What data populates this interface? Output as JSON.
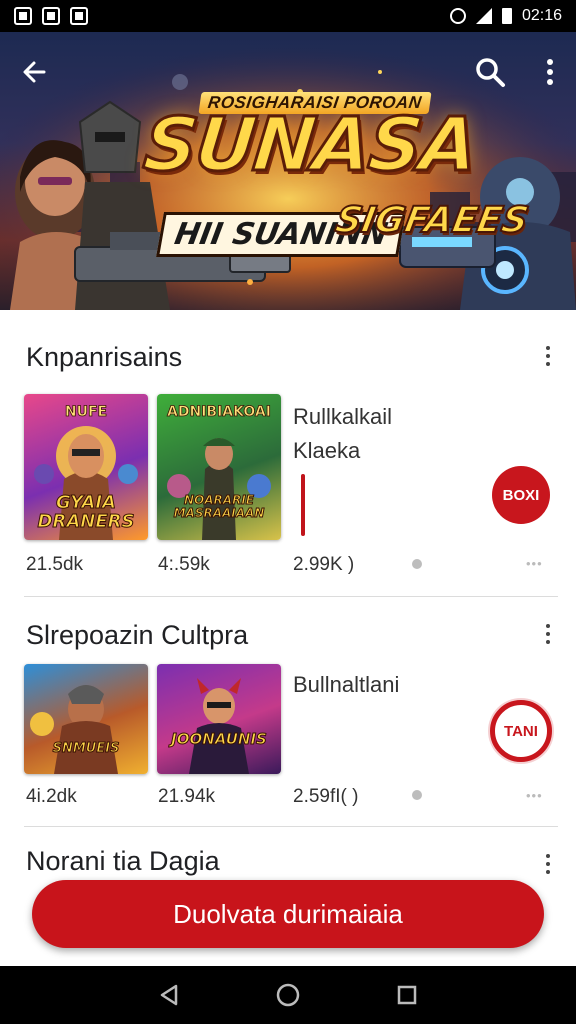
{
  "status_bar": {
    "time": "02:16",
    "icons": [
      "app-icon",
      "app-icon",
      "app-icon",
      "alarm-icon",
      "signal-icon",
      "battery-icon"
    ]
  },
  "hero": {
    "subtitle": "ROSIGHARAISI POROAN",
    "title": "SUNASA",
    "tagline_left": "HII SUANINN",
    "tagline_right": "SIGFAEES",
    "icons": [
      "back-arrow-icon",
      "search-icon",
      "more-vert-icon"
    ]
  },
  "sections": [
    {
      "title": "Knpanrisains",
      "games": [
        {
          "top": "NUFE",
          "label": "GYAIA DRANERS",
          "count": "21.5dk",
          "colors": [
            "#e8488a",
            "#7b2fb0",
            "#ff9a2a"
          ]
        },
        {
          "top": "ADNIBIAKOAI",
          "label": "NOARARIE MASRAAIAAN",
          "count": "4:.59k",
          "colors": [
            "#3fae3a",
            "#2c6b3a",
            "#d8c24a"
          ]
        }
      ],
      "side_title": "Rullkalkail",
      "side_subtitle": "Klaeka",
      "side_count": "2.99K )",
      "button_label": "BOXI",
      "button_style": "filled"
    },
    {
      "title": "Slrepoazin Cultpra",
      "games": [
        {
          "top": "",
          "label": "SNMUEIS",
          "count": "4i.2dk",
          "colors": [
            "#2e8fd8",
            "#b85a2a",
            "#f0b030"
          ]
        },
        {
          "top": "",
          "label": "JOONAUNIS",
          "count": "21.94k",
          "colors": [
            "#7b2fb0",
            "#c43a8a",
            "#3a1a5a"
          ]
        }
      ],
      "side_title": "Bullnaltlani",
      "side_subtitle": "",
      "side_count": "2.59fI( )",
      "button_label": "TANI",
      "button_style": "outline"
    },
    {
      "title": "Norani tia Dagia"
    }
  ],
  "cta": {
    "label": "Duolvata durimaiaia"
  },
  "nav_bar": {
    "icons": [
      "back-triangle-icon",
      "home-circle-icon",
      "recents-square-icon"
    ]
  },
  "colors": {
    "accent": "#c8141b",
    "status_bar": "#000000"
  }
}
